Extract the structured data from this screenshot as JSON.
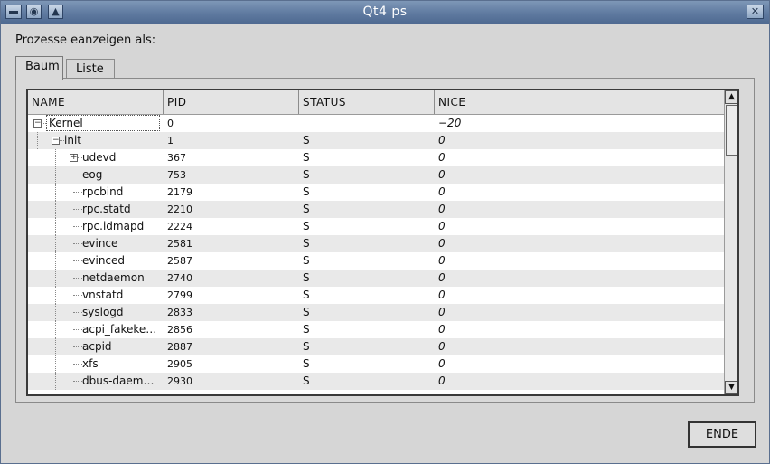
{
  "window": {
    "title": "Qt4 ps"
  },
  "prompt_label": "Prozesse eanzeigen als:",
  "tabs": [
    {
      "label": "Baum",
      "active": true
    },
    {
      "label": "Liste",
      "active": false
    }
  ],
  "columns": [
    "NAME",
    "PID",
    "STATUS",
    "NICE"
  ],
  "rows": [
    {
      "name": "Kernel",
      "pid": "0",
      "status": "",
      "nice": "−20",
      "depth": 0,
      "expander": "minus"
    },
    {
      "name": "init",
      "pid": "1",
      "status": "S",
      "nice": "0",
      "depth": 1,
      "expander": "minus"
    },
    {
      "name": "udevd",
      "pid": "367",
      "status": "S",
      "nice": "0",
      "depth": 2,
      "expander": "plus"
    },
    {
      "name": "eog",
      "pid": "753",
      "status": "S",
      "nice": "0",
      "depth": 2,
      "expander": ""
    },
    {
      "name": "rpcbind",
      "pid": "2179",
      "status": "S",
      "nice": "0",
      "depth": 2,
      "expander": ""
    },
    {
      "name": "rpc.statd",
      "pid": "2210",
      "status": "S",
      "nice": "0",
      "depth": 2,
      "expander": ""
    },
    {
      "name": "rpc.idmapd",
      "pid": "2224",
      "status": "S",
      "nice": "0",
      "depth": 2,
      "expander": ""
    },
    {
      "name": "evince",
      "pid": "2581",
      "status": "S",
      "nice": "0",
      "depth": 2,
      "expander": ""
    },
    {
      "name": "evinced",
      "pid": "2587",
      "status": "S",
      "nice": "0",
      "depth": 2,
      "expander": ""
    },
    {
      "name": "netdaemon",
      "pid": "2740",
      "status": "S",
      "nice": "0",
      "depth": 2,
      "expander": ""
    },
    {
      "name": "vnstatd",
      "pid": "2799",
      "status": "S",
      "nice": "0",
      "depth": 2,
      "expander": ""
    },
    {
      "name": "syslogd",
      "pid": "2833",
      "status": "S",
      "nice": "0",
      "depth": 2,
      "expander": ""
    },
    {
      "name": "acpi_fakeke…",
      "pid": "2856",
      "status": "S",
      "nice": "0",
      "depth": 2,
      "expander": ""
    },
    {
      "name": "acpid",
      "pid": "2887",
      "status": "S",
      "nice": "0",
      "depth": 2,
      "expander": ""
    },
    {
      "name": "xfs",
      "pid": "2905",
      "status": "S",
      "nice": "0",
      "depth": 2,
      "expander": ""
    },
    {
      "name": "dbus-daem…",
      "pid": "2930",
      "status": "S",
      "nice": "0",
      "depth": 2,
      "expander": ""
    }
  ],
  "buttons": {
    "ende": "ENDE"
  },
  "icons": {
    "menu": "window-menu-icon",
    "pin": "pin-icon",
    "up": "raise-icon",
    "close": "close-icon"
  }
}
